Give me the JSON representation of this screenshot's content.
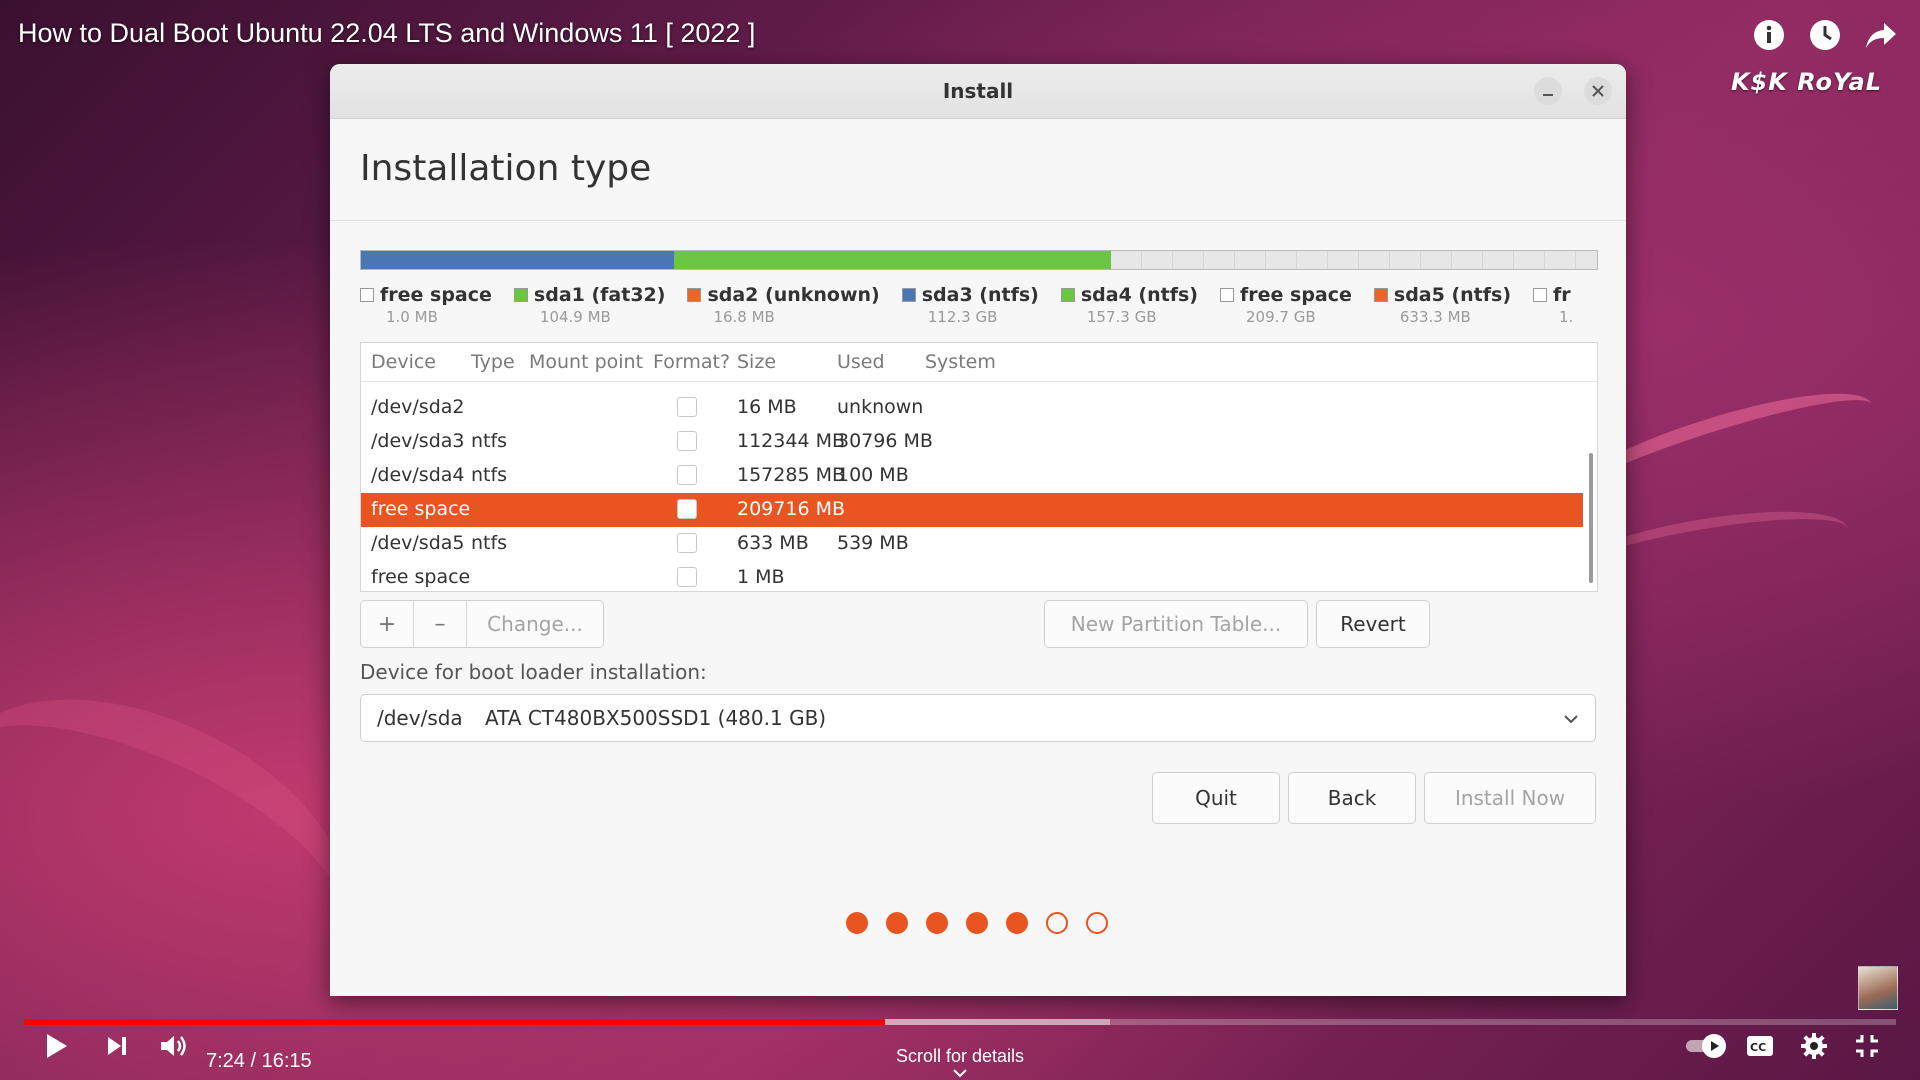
{
  "video": {
    "title": "How to Dual Boot Ubuntu 22.04 LTS and Windows 11 [ 2022 ]",
    "channel": "K$K RoYaL",
    "time_current": "7:24",
    "time_separator": " / ",
    "time_total": "16:15",
    "scroll_hint": "Scroll for details",
    "progress_played": 0.46,
    "progress_buffered": 0.58,
    "icons": [
      "info-icon",
      "watch-later-icon",
      "share-icon",
      "play-icon",
      "next-icon",
      "volume-icon",
      "autoplay-toggle-icon",
      "captions-icon",
      "settings-icon",
      "exit-fullscreen-icon"
    ],
    "progress_color": "#ff0000"
  },
  "window": {
    "title": "Install",
    "heading": "Installation type",
    "accent_color": "#e95420"
  },
  "partition_bar": {
    "segments": [
      {
        "kind": "blue",
        "share": 0.253
      },
      {
        "kind": "green",
        "share": 0.354
      },
      {
        "kind": "free",
        "share": 0.393
      }
    ]
  },
  "legend": [
    {
      "name": "free space",
      "size": "1.0 MB",
      "color": "#ffffff"
    },
    {
      "name": "sda1 (fat32)",
      "size": "104.9 MB",
      "color": "#6cc644"
    },
    {
      "name": "sda2 (unknown)",
      "size": "16.8 MB",
      "color": "#e8672b"
    },
    {
      "name": "sda3 (ntfs)",
      "size": "112.3 GB",
      "color": "#4a76b4"
    },
    {
      "name": "sda4 (ntfs)",
      "size": "157.3 GB",
      "color": "#6cc644"
    },
    {
      "name": "free space",
      "size": "209.7 GB",
      "color": "#ffffff"
    },
    {
      "name": "sda5 (ntfs)",
      "size": "633.3 MB",
      "color": "#e8672b"
    },
    {
      "name": "fr",
      "size": "1.",
      "color": "#ffffff"
    }
  ],
  "table": {
    "headers": {
      "device": "Device",
      "type": "Type",
      "mount": "Mount point",
      "format": "Format?",
      "size": "Size",
      "used": "Used",
      "system": "System"
    },
    "rows": [
      {
        "device": "/dev/sda2",
        "type": "",
        "size": "16 MB",
        "used": "unknown",
        "selected": false
      },
      {
        "device": "/dev/sda3",
        "type": "ntfs",
        "size": "112344 MB",
        "used": "30796 MB",
        "selected": false
      },
      {
        "device": "/dev/sda4",
        "type": "ntfs",
        "size": "157285 MB",
        "used": "100 MB",
        "selected": false
      },
      {
        "device": "free space",
        "type": "",
        "size": "209716 MB",
        "used": "",
        "selected": true
      },
      {
        "device": "/dev/sda5",
        "type": "ntfs",
        "size": "633 MB",
        "used": "539 MB",
        "selected": false
      },
      {
        "device": "free space",
        "type": "",
        "size": "1 MB",
        "used": "",
        "selected": false
      }
    ]
  },
  "toolbar": {
    "add": "+",
    "remove": "–",
    "change": "Change...",
    "new_table": "New Partition Table...",
    "revert": "Revert"
  },
  "bootloader": {
    "label": "Device for boot loader installation:",
    "device": "/dev/sda",
    "name": "ATA CT480BX500SSD1 (480.1 GB)"
  },
  "actions": {
    "quit": "Quit",
    "back": "Back",
    "install": "Install Now"
  },
  "steps": {
    "total": 7,
    "done": 5
  }
}
